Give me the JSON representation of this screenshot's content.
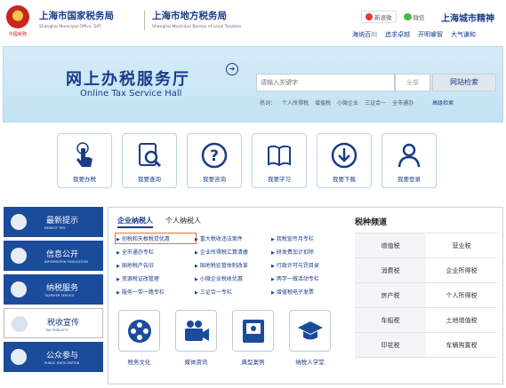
{
  "header": {
    "emblem_text": "中國稅務",
    "state_title": "上海市国家税务局",
    "state_sub": "Shanghai Municipal Office, SAT",
    "local_title": "上海市地方税务局",
    "local_sub": "Shanghai Municipal Bureau of Local Taxation",
    "weibo_label": "新浪微",
    "wechat_label": "微信",
    "city_title": "上海城市精神",
    "city_links": [
      "海纳百川",
      "追求卓越",
      "开明睿智",
      "大气谦和"
    ]
  },
  "banner": {
    "title": "网上办税服务厅",
    "title_en": "Online Tax Service Hall",
    "search_placeholder": "请输入关键字",
    "search_scope": "全部",
    "search_button": "网站检索",
    "hot_label": "热词：",
    "hot_words": [
      "个人所得税",
      "增值税",
      "小微企业",
      "三证合一",
      "全市通办"
    ],
    "advanced": "高级检索"
  },
  "tiles": [
    {
      "label": "我要办税",
      "icon": "hand-pointer-icon"
    },
    {
      "label": "我要查询",
      "icon": "magnifier-icon"
    },
    {
      "label": "我要咨询",
      "icon": "question-icon"
    },
    {
      "label": "我要学习",
      "icon": "book-icon"
    },
    {
      "label": "我要下载",
      "icon": "download-icon"
    },
    {
      "label": "我要登录",
      "icon": "user-icon"
    }
  ],
  "left_nav": [
    {
      "label": "最新提示",
      "en": "NEWEST TIPS",
      "active": false
    },
    {
      "label": "信息公开",
      "en": "INFORMATION PUBLICATION",
      "active": false
    },
    {
      "label": "纳税服务",
      "en": "TAXPAYER SERVICE",
      "active": false
    },
    {
      "label": "税收宣传",
      "en": "TAX PUBLICITY",
      "active": true
    },
    {
      "label": "公众参与",
      "en": "PUBLIC PARTICIPATION",
      "active": false
    }
  ],
  "panel": {
    "tabs": [
      "企业纳税人",
      "个人纳税人"
    ],
    "links": [
      "创税和天根税贷优惠",
      "重大税收违法案件",
      "我税宣传月专栏",
      "全市通办专栏",
      "企业所得税汇算清缴",
      "研发费加计扣除",
      "国地税产告旧",
      "国地税征管体制改革",
      "行政许可与罚目录",
      "资源税证改管理",
      "小微企业税收优惠",
      "两学一做活动专栏",
      "服务一带一路专栏",
      "三证合一专栏",
      "增值税电子发票"
    ],
    "features": [
      "税务文化",
      "媒体资讯",
      "典型案例",
      "纳税人学堂"
    ],
    "channel_title": "税种频道",
    "channel": [
      [
        "增值税",
        "营业税"
      ],
      [
        "消费税",
        "企业所得税"
      ],
      [
        "房产税",
        "个人所得税"
      ],
      [
        "车船税",
        "土地增值税"
      ],
      [
        "印花税",
        "车辆购置税"
      ]
    ]
  },
  "colors": {
    "brand_blue": "#1b4b9b",
    "title_blue": "#1a3c8a",
    "highlight": "#e8732a",
    "banner_bg": "#d6ecf8"
  }
}
